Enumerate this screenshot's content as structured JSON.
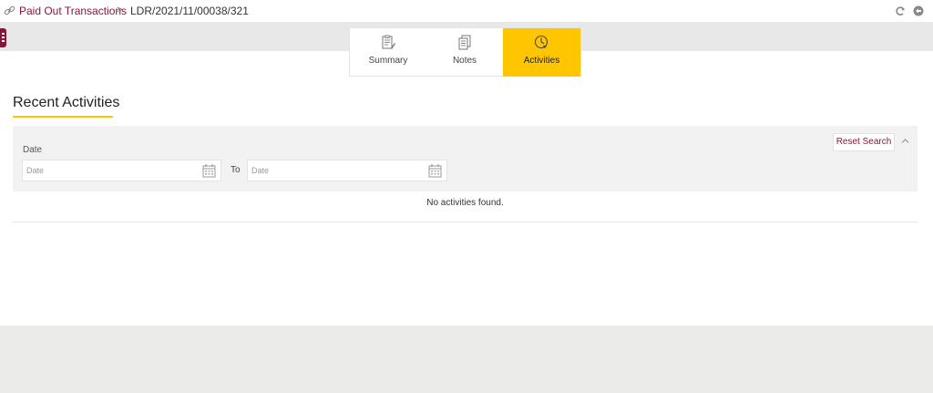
{
  "breadcrumb": {
    "parent_label": "Paid Out Transactions",
    "separator": ">",
    "current_label": "LDR/2021/11/00038/321"
  },
  "toolbar_icons": [
    "refresh-icon",
    "back-icon"
  ],
  "tabs": [
    {
      "label": "Summary",
      "icon": "summary-icon",
      "active": false
    },
    {
      "label": "Notes",
      "icon": "notes-icon",
      "active": false
    },
    {
      "label": "Activities",
      "icon": "activities-icon",
      "active": true
    }
  ],
  "section": {
    "title": "Recent Activities"
  },
  "filter": {
    "date_label": "Date",
    "from_placeholder": "Date",
    "to_label": "To",
    "to_placeholder": "Date",
    "reset_label": "Reset Search"
  },
  "results": {
    "empty_message": "No activities found."
  },
  "colors": {
    "accent": "#ffc600",
    "brand": "#8a1538"
  }
}
